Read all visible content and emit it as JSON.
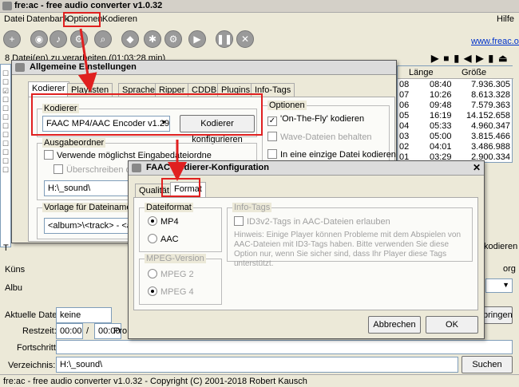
{
  "app": {
    "title": "fre:ac - free audio converter v1.0.32"
  },
  "menu": {
    "items": [
      "Datei",
      "Datenbank",
      "Optionen",
      "Kodieren"
    ],
    "help": "Hilfe"
  },
  "toolbar": {
    "website": "www.freac.org"
  },
  "main": {
    "status_line": "8 Datei(en) zu verarbeiten (01:03:28 min)",
    "col_length": "Länge",
    "col_size": "Größe",
    "rows": [
      {
        "n": "08",
        "len": "08:40",
        "size": "7.936.305"
      },
      {
        "n": "07",
        "len": "10:26",
        "size": "8.613.328"
      },
      {
        "n": "06",
        "len": "09:48",
        "size": "7.579.363"
      },
      {
        "n": "05",
        "len": "16:19",
        "size": "14.152.658"
      },
      {
        "n": "04",
        "len": "05:33",
        "size": "4.960.347"
      },
      {
        "n": "03",
        "len": "05:00",
        "size": "3.815.466"
      },
      {
        "n": "02",
        "len": "04:01",
        "size": "3.486.988"
      },
      {
        "n": "01",
        "len": "03:29",
        "size": "2.900.334"
      }
    ],
    "kuenstler_label": "Küns",
    "album_label": "Albu",
    "t_label": "T",
    "kodieren_right": "kodieren",
    "org_right": "org",
    "bringen": "bringen",
    "current_file_label": "Aktuelle Datei:",
    "current_file": "keine",
    "time_label": "Restzeit:",
    "time_a": "00:00",
    "time_sep": "/",
    "time_b": "00:00",
    "pro": "Pro",
    "progress_label": "Fortschritt:",
    "dir_label": "Verzeichnis:",
    "dir_value": "H:\\_sound\\",
    "search_btn": "Suchen",
    "statusbar": "fre:ac - free audio converter v1.0.32 - Copyright (C) 2001-2018 Robert Kausch"
  },
  "settings": {
    "title": "Allgemeine Einstellungen",
    "tabs": [
      "Kodierer",
      "Playlisten",
      "Sprache",
      "Ripper",
      "CDDB",
      "Plugins",
      "Info-Tags"
    ],
    "encoder_group": "Kodierer",
    "encoder_value": "FAAC MP4/AAC Encoder v1.29.9",
    "configure_btn": "Kodierer konfigurieren",
    "output_group": "Ausgabeordner",
    "use_input_dir": "Verwende möglichst Eingabedateiordne",
    "overwrite": "Überschreiben der D",
    "out_dir": "H:\\_sound\\",
    "filename_group": "Vorlage für Dateinamen",
    "filename_value": "<album>\\<track> - <artist>",
    "options_group": "Optionen",
    "on_the_fly": "'On-The-Fly' kodieren",
    "keep_wave": "Wave-Dateien behalten",
    "single_file": "In eine einzige Datei kodieren"
  },
  "faac": {
    "title": "FAAC Kodierer-Konfiguration",
    "tabs": [
      "Qualität",
      "Format"
    ],
    "file_format_group": "Dateiformat",
    "mp4": "MP4",
    "aac": "AAC",
    "mpeg_group": "MPEG-Version",
    "mpeg2": "MPEG 2",
    "mpeg4": "MPEG 4",
    "info_group": "Info-Tags",
    "id3v2": "ID3v2-Tags in AAC-Dateien erlauben",
    "hint": "Hinweis: Einige Player können Probleme mit dem Abspielen von AAC-Dateien mit ID3-Tags haben. Bitte verwenden Sie diese Option nur, wenn Sie sicher sind, dass Ihr Player diese Tags unterstützt.",
    "cancel_btn": "Abbrechen",
    "ok_btn": "OK"
  },
  "colors": {
    "highlight": "#e02020",
    "link": "#0033cc"
  }
}
